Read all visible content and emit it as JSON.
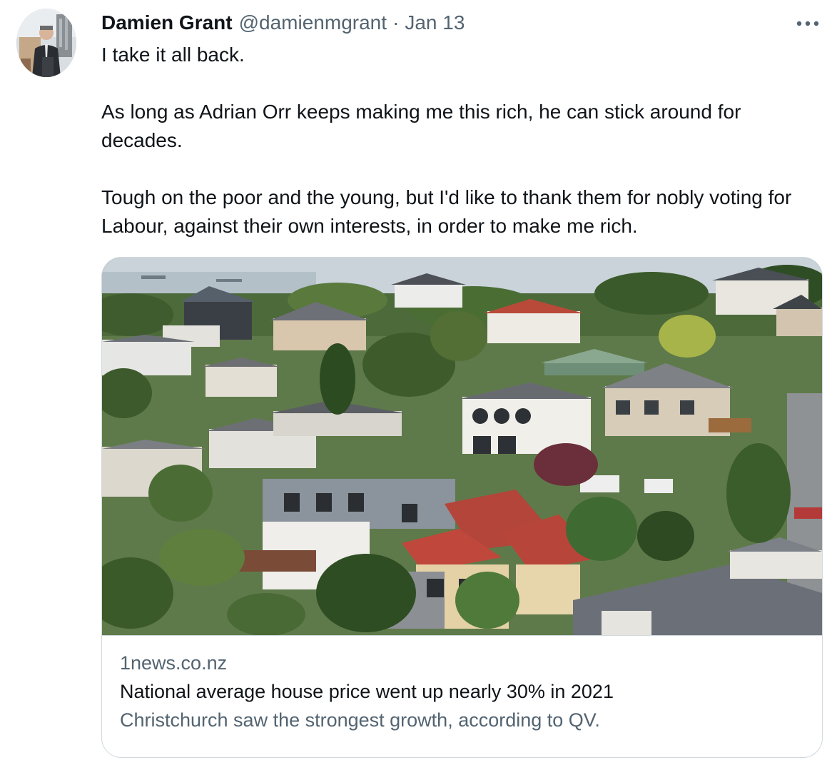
{
  "tweet": {
    "author": {
      "display_name": "Damien Grant",
      "handle": "@damienmgrant"
    },
    "separator": "·",
    "date": "Jan 13",
    "more_icon": "more-horizontal-icon",
    "paragraphs": [
      "I take it all back.",
      "As long as Adrian Orr keeps making me this rich, he can stick around for decades.",
      "Tough on the poor and the young, but I'd like to thank them for nobly voting for Labour, against their own interests, in order to make me rich."
    ],
    "card": {
      "domain": "1news.co.nz",
      "title": "National average house price went up nearly 30% in 2021",
      "description": "Christchurch saw the strongest growth, according to QV.",
      "image_alt": "Aerial view of hillside suburban houses"
    }
  },
  "colors": {
    "text_primary": "#0f1419",
    "text_secondary": "#536471",
    "card_border": "#cfd9de"
  }
}
